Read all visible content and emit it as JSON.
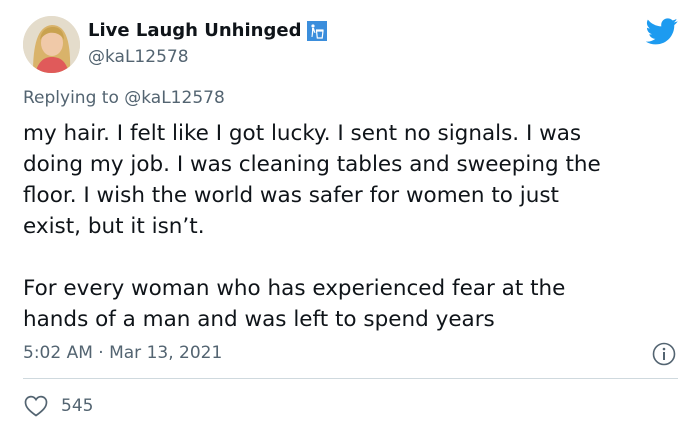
{
  "author": {
    "display_name": "Live Laugh Unhinged",
    "handle": "@kaL12578",
    "badge_icon": "trash-person-icon",
    "avatar_icon": "profile-photo"
  },
  "brand": {
    "icon": "twitter-bird-icon",
    "color": "#1d9bf0"
  },
  "reply": {
    "prefix": "Replying to",
    "mention": "@kaL12578"
  },
  "body": {
    "lines": [
      "my hair. I felt like I got lucky. I sent no signals. I was",
      "doing my job. I was cleaning tables and sweeping the",
      "floor. I wish the world was safer for women to just",
      "exist, but it isn’t.",
      "For every woman who has experienced fear at the",
      "hands of a man and was left to spend years"
    ]
  },
  "meta": {
    "timestamp": "5:02 AM · Mar 13, 2021",
    "info_icon": "info-icon"
  },
  "engagement": {
    "like_icon": "heart-outline-icon",
    "like_count": "545"
  },
  "colors": {
    "text_primary": "#0f1419",
    "text_secondary": "#536471",
    "divider": "#cfd9de"
  }
}
